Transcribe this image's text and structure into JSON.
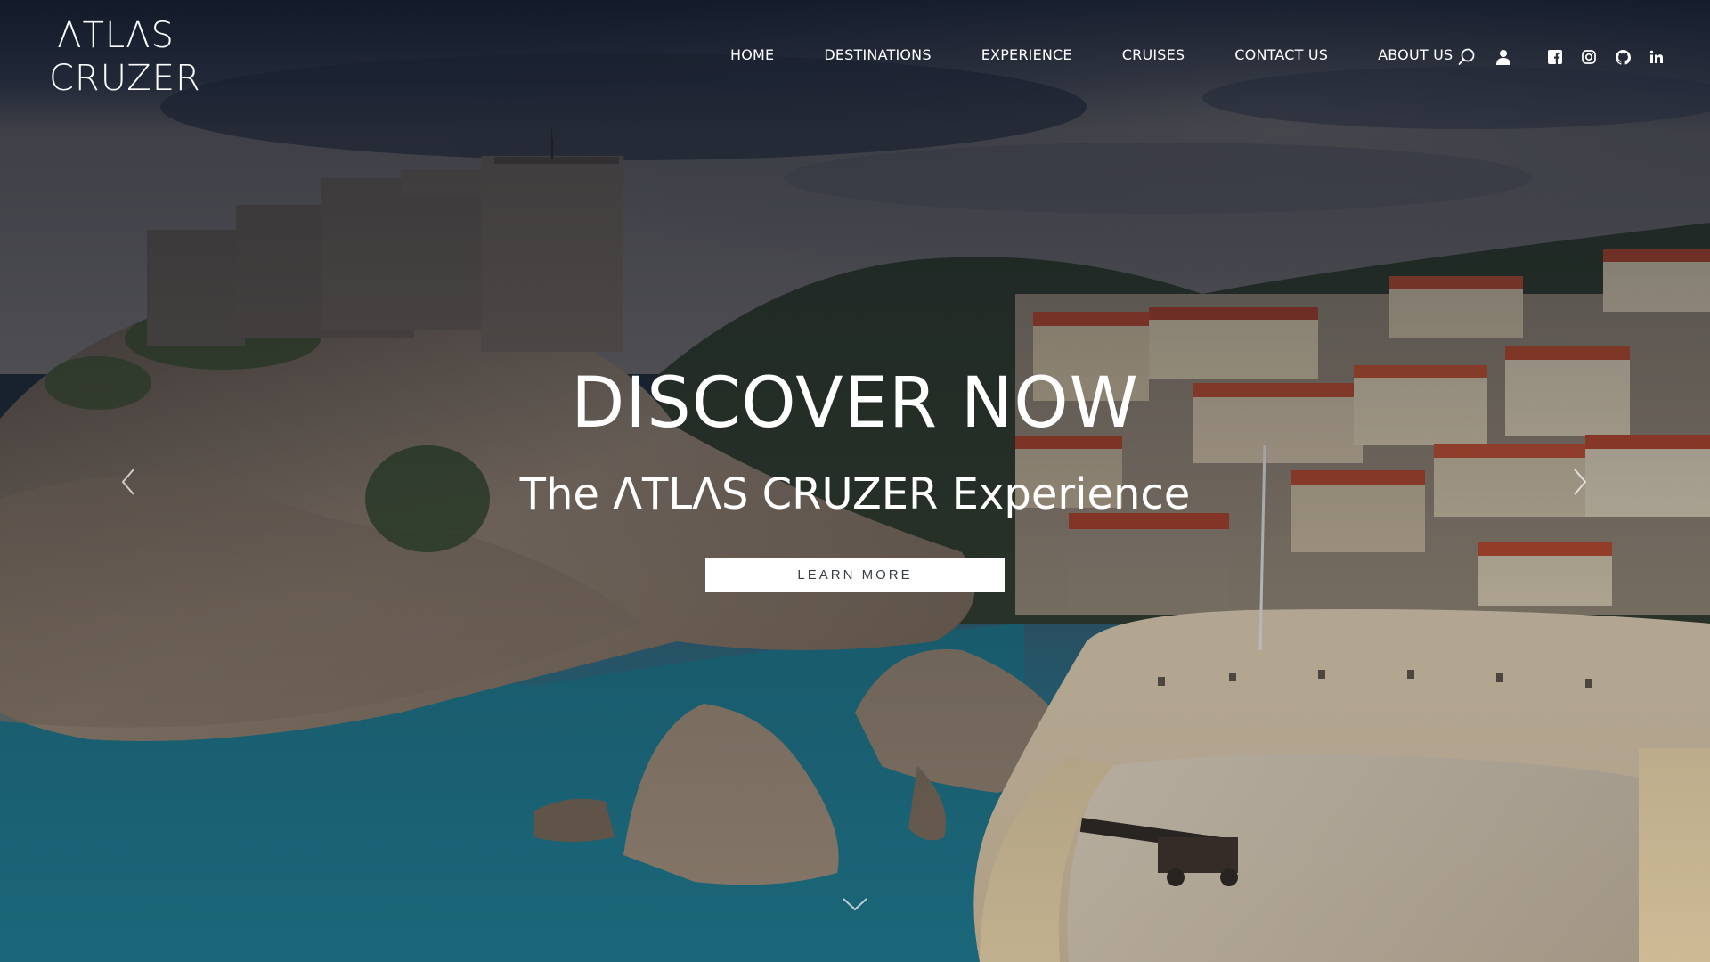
{
  "brand": {
    "line1": "ΛTLΛS",
    "line2": "CRUZER"
  },
  "nav": {
    "items": [
      {
        "label": "HOME",
        "name": "nav-item-home"
      },
      {
        "label": "DESTINATIONS",
        "name": "nav-item-destinations"
      },
      {
        "label": "EXPERIENCE",
        "name": "nav-item-experience"
      },
      {
        "label": "CRUISES",
        "name": "nav-item-cruises"
      },
      {
        "label": "CONTACT US",
        "name": "nav-item-contact-us"
      },
      {
        "label": "ABOUT US",
        "name": "nav-item-about-us"
      }
    ]
  },
  "header_icons": [
    "search-icon",
    "user-icon",
    "facebook-icon",
    "instagram-icon",
    "github-icon",
    "linkedin-icon"
  ],
  "hero": {
    "title": "DISCOVER NOW",
    "subtitle": "The ΛTLΛS CRUZER Experience",
    "cta_label": "LEARN MORE"
  },
  "carousel": {
    "prev_icon": "chevron-left-icon",
    "next_icon": "chevron-right-icon",
    "scroll_icon": "chevron-down-icon"
  },
  "colors": {
    "text": "#ffffff",
    "button_bg": "#ffffff",
    "button_text": "#3a3f47"
  }
}
